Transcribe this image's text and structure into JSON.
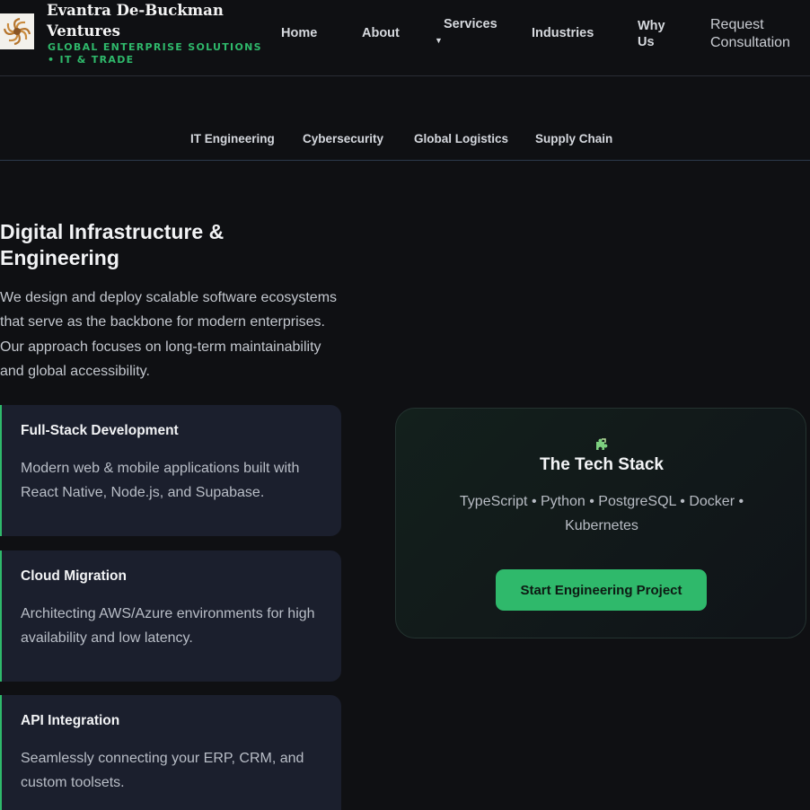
{
  "brand": {
    "name": "Evantra De-Buckman Ventures",
    "tagline": "GLOBAL ENTERPRISE SOLUTIONS • IT & TRADE",
    "logo_icon": "spiral-logo-icon"
  },
  "nav": {
    "home": "Home",
    "about": "About",
    "services": "Services",
    "services_arrow": "▼",
    "industries": "Industries",
    "why_us": "Why Us",
    "cta": "Request Consultation"
  },
  "subnav": [
    "IT Engineering",
    "Cybersecurity",
    "Global Logistics",
    "Supply Chain"
  ],
  "hero": {
    "title": "Digital Infrastructure & Engineering",
    "lead": "We design and deploy scalable software ecosystems that serve as the backbone for modern enterprises. Our approach focuses on long-term maintainability and global accessibility."
  },
  "cards": [
    {
      "title": "Full-Stack Development",
      "desc": "Modern web & mobile applications built with React Native, Node.js, and Supabase."
    },
    {
      "title": "Cloud Migration",
      "desc": "Architecting AWS/Azure environments for high availability and low latency."
    },
    {
      "title": "API Integration",
      "desc": "Seamlessly connecting your ERP, CRM, and custom toolsets."
    }
  ],
  "stack": {
    "icon": "puzzle-icon",
    "icon_glyph": "🧩",
    "title": "The Tech Stack",
    "list": "TypeScript • Python • PostgreSQL • Docker • Kubernetes",
    "button": "Start Engineering Project"
  },
  "colors": {
    "accent": "#2fb96b",
    "background": "#0f1013",
    "card": "#1b1f2d"
  }
}
